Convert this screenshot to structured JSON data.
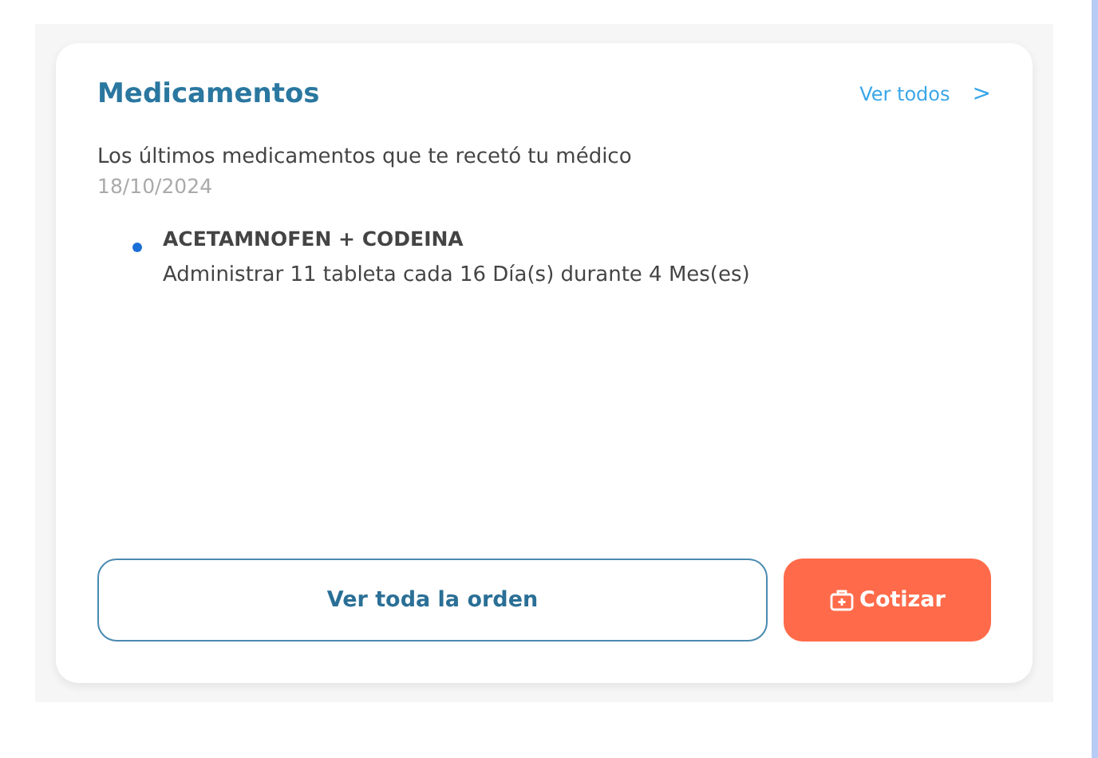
{
  "card": {
    "title": "Medicamentos",
    "link": {
      "label": "Ver todos",
      "icon": ">"
    },
    "intro": "Los últimos medicamentos que te recetó tu médico",
    "date": "18/10/2024",
    "medications": [
      {
        "name": "ACETAMNOFEN + CODEINA",
        "instructions": "Administrar 11 tableta cada 16 Día(s) durante 4 Mes(es)"
      }
    ],
    "buttons": [
      {
        "kind": "outline",
        "label": "Ver toda la orden"
      },
      {
        "kind": "primary",
        "label": "Cotizar"
      }
    ]
  }
}
